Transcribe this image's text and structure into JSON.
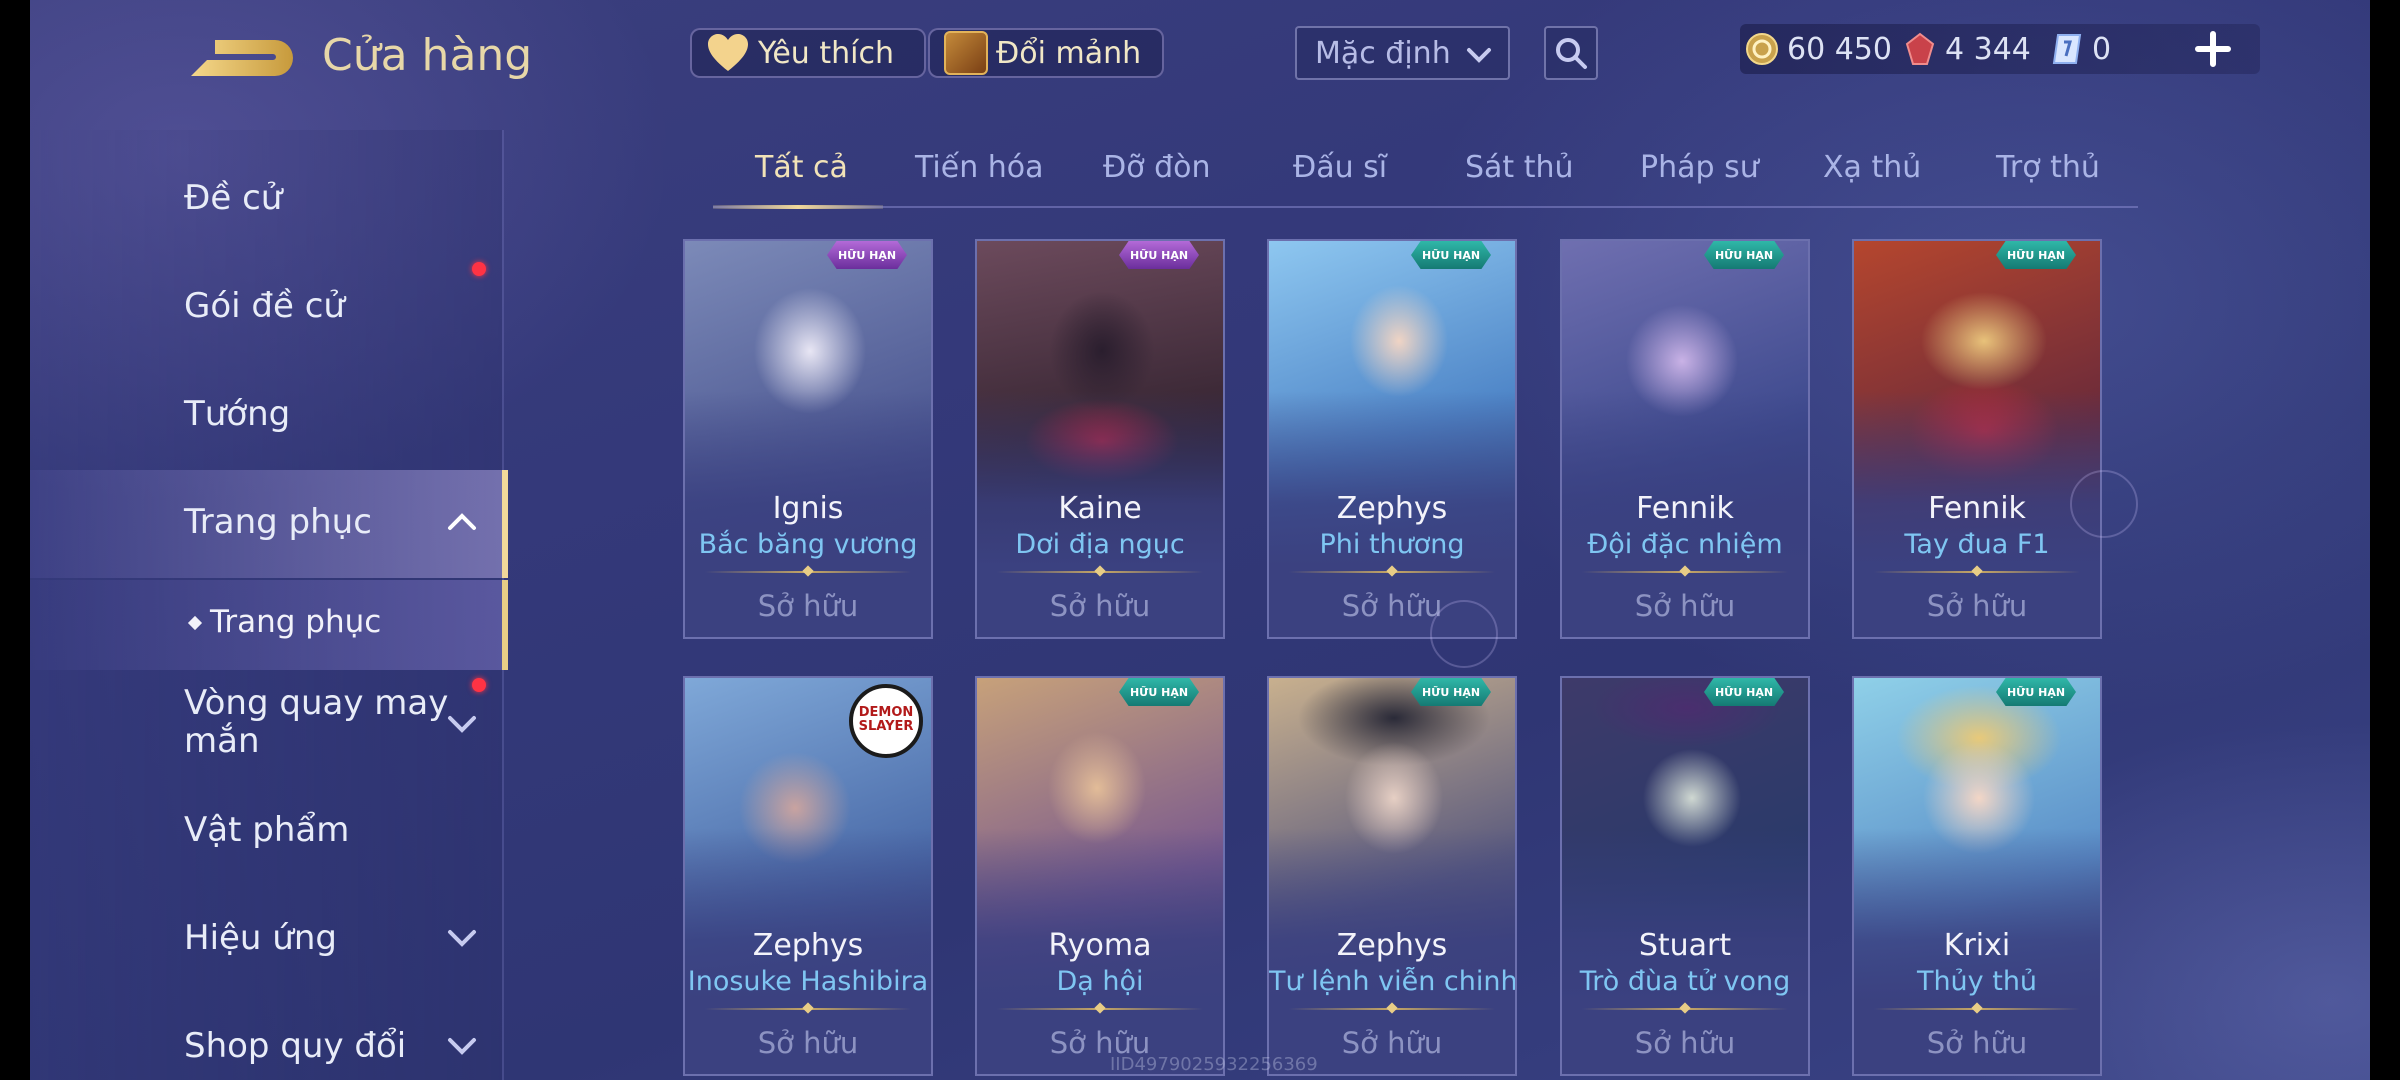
{
  "header": {
    "title": "Cửa hàng",
    "favorite_label": "Yêu thích",
    "exchange_label": "Đổi mảnh",
    "sort_value": "Mặc định",
    "currencies": {
      "gold": "60 450",
      "ruby": "4 344",
      "ticket": "0"
    }
  },
  "sidebar": {
    "items": [
      {
        "label": "Đề cử"
      },
      {
        "label": "Gói đề cử"
      },
      {
        "label": "Tướng"
      },
      {
        "label": "Trang phục"
      },
      {
        "label": "Vòng quay may mắn"
      },
      {
        "label": "Vật phẩm"
      },
      {
        "label": "Hiệu ứng"
      },
      {
        "label": "Shop quy đổi"
      }
    ],
    "sub_item": "Trang phục"
  },
  "tabs": [
    "Tất cả",
    "Tiến hóa",
    "Đỡ đòn",
    "Đấu sĩ",
    "Sát thủ",
    "Pháp sư",
    "Xạ thủ",
    "Trợ thủ"
  ],
  "active_tab": "Tất cả",
  "cards": [
    {
      "hero": "Ignis",
      "skin": "Bắc băng vương",
      "status": "Sở hữu",
      "badge_tier": "S",
      "badge_text": "HỮU HẠN"
    },
    {
      "hero": "Kaine",
      "skin": "Dơi địa ngục",
      "status": "Sở hữu",
      "badge_tier": "S",
      "badge_text": "HỮU HẠN"
    },
    {
      "hero": "Zephys",
      "skin": "Phi thương",
      "status": "Sở hữu",
      "badge_tier": "A",
      "badge_text": "HỮU HẠN"
    },
    {
      "hero": "Fennik",
      "skin": "Đội đặc nhiệm",
      "status": "Sở hữu",
      "badge_tier": "A",
      "badge_text": "HỮU HẠN"
    },
    {
      "hero": "Fennik",
      "skin": "Tay đua F1",
      "status": "Sở hữu",
      "badge_tier": "A",
      "badge_text": "HỮU HẠN"
    },
    {
      "hero": "Zephys",
      "skin": "Inosuke Hashibira",
      "status": "Sở hữu",
      "badge_text": "DEMON SLAYER"
    },
    {
      "hero": "Ryoma",
      "skin": "Dạ hội",
      "status": "Sở hữu",
      "badge_tier": "A",
      "badge_text": "HỮU HẠN"
    },
    {
      "hero": "Zephys",
      "skin": "Tư lệnh viễn chinh",
      "status": "Sở hữu",
      "badge_tier": "A",
      "badge_text": "HỮU HẠN"
    },
    {
      "hero": "Stuart",
      "skin": "Trò đùa tử vong",
      "status": "Sở hữu",
      "badge_tier": "A",
      "badge_text": "HỮU HẠN"
    },
    {
      "hero": "Krixi",
      "skin": "Thủy thủ",
      "status": "Sở hữu",
      "badge_tier": "A",
      "badge_text": "HỮU HẠN"
    }
  ],
  "watermark": "IID4979025932256369",
  "colors": {
    "accent_gold": "#f1d89a",
    "skin_name_blue": "#7fc6f2",
    "notification_red": "#ff3344",
    "background": "#34397a"
  }
}
